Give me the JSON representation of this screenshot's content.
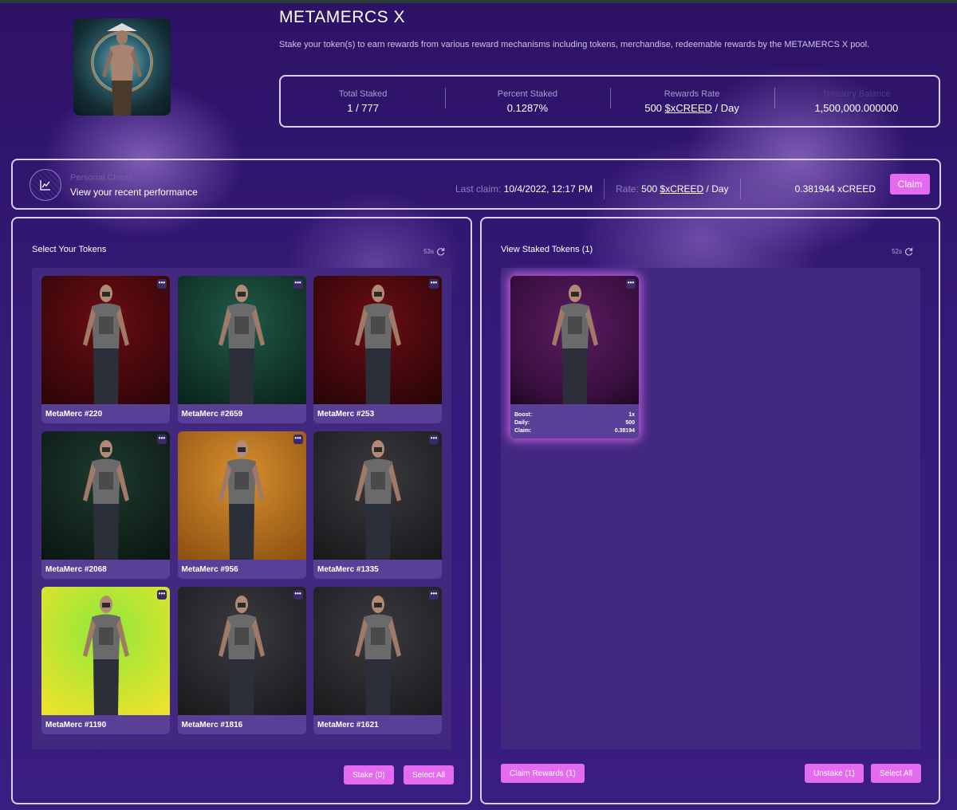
{
  "pool": {
    "title": "METAMERCS X",
    "description": "Stake your token(s) to earn rewards from various reward mechanisms including tokens, merchandise, redeemable rewards by the METAMERCS X pool."
  },
  "stats": {
    "total_staked_label": "Total Staked",
    "total_staked_value": "1 / 777",
    "percent_staked_label": "Percent Staked",
    "percent_staked_value": "0.1287%",
    "rewards_rate_label": "Rewards Rate",
    "rewards_rate_amount": "500",
    "rewards_rate_token": "$xCREED",
    "rewards_rate_unit": "/ Day",
    "treasury_label": "Treasury Balance",
    "treasury_value": "1,500,000.000000"
  },
  "charts_bar": {
    "label": "Personal Charts",
    "subtitle": "View your recent performance",
    "last_claim_label": "Last claim:",
    "last_claim_value": "10/4/2022, 12:17 PM",
    "rate_label": "Rate:",
    "rate_amount": "500",
    "rate_token": "$xCREED",
    "rate_unit": "/ Day",
    "earnings_label": "Earnings:",
    "earnings_value": "0.381944 xCREED",
    "claim_button": "Claim"
  },
  "left_panel": {
    "title": "Select Your Tokens",
    "refresh_text": "53s",
    "tokens": [
      {
        "name": "MetaMerc #220",
        "bg": "#6a0d14",
        "bg2": "#2a0506"
      },
      {
        "name": "MetaMerc #2659",
        "bg": "#1f5a48",
        "bg2": "#0a2219"
      },
      {
        "name": "MetaMerc #253",
        "bg": "#6a0d14",
        "bg2": "#250506"
      },
      {
        "name": "MetaMerc #2068",
        "bg": "#1d3a2e",
        "bg2": "#0b1510"
      },
      {
        "name": "MetaMerc #956",
        "bg": "#d8902e",
        "bg2": "#8a4f10"
      },
      {
        "name": "MetaMerc #1335",
        "bg": "#3a3a3e",
        "bg2": "#18181b"
      },
      {
        "name": "MetaMerc #1190",
        "bg": "#8ee83a",
        "bg2": "#f4e22a"
      },
      {
        "name": "MetaMerc #1816",
        "bg": "#3b3b3f",
        "bg2": "#19191c"
      },
      {
        "name": "MetaMerc #1621",
        "bg": "#3a3a3e",
        "bg2": "#1a1a1d"
      }
    ],
    "more_glyph": "•••",
    "stake_button": "Stake (0)",
    "select_all_button": "Select All"
  },
  "right_panel": {
    "title": "View Staked Tokens (1)",
    "refresh_text": "52s",
    "staked": {
      "boost_label": "Boost:",
      "boost_value": "1x",
      "daily_label": "Daily:",
      "daily_value": "500",
      "claim_label": "Claim:",
      "claim_value": "0.38194",
      "bg": "#3a0f40"
    },
    "claim_rewards_button": "Claim Rewards (1)",
    "unstake_button": "Unstake (1)",
    "select_all_button": "Select All"
  },
  "colors": {
    "accent": "#e46bf0",
    "background": "#2d1266",
    "panel_border": "#d9cff0"
  },
  "icons": {
    "chart_icon": "line-chart-icon",
    "refresh_icon": "refresh-icon",
    "more_icon": "more-options-icon"
  }
}
